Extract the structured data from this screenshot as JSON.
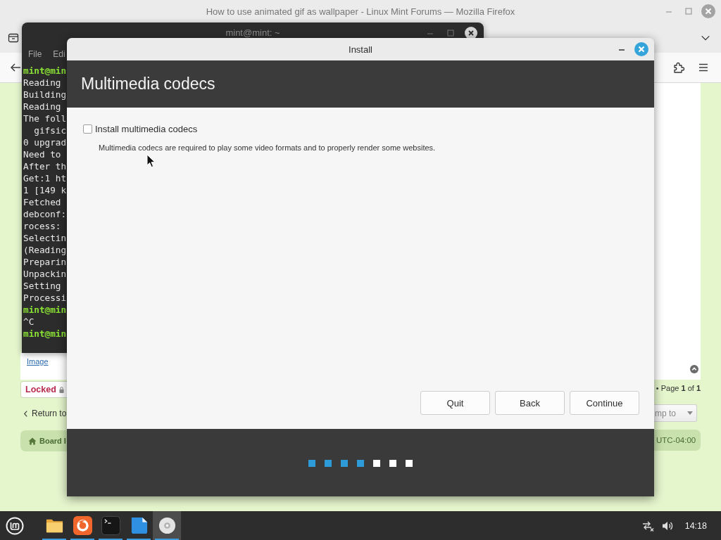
{
  "browser": {
    "title": "How to use animated gif as wallpaper - Linux Mint Forums — Mozilla Firefox",
    "page": {
      "image_link": "Image",
      "locked_button": "Locked",
      "pagination": "• Page **1** of **1**",
      "return_link": "Return to",
      "jump_to": "mp to",
      "breadcrumb": "Board I",
      "timezone": "UTC-04:00"
    }
  },
  "terminal": {
    "title": "mint@mint: ~",
    "menu": [
      "File",
      "Edi"
    ],
    "lines": [
      {
        "kind": "prompt",
        "text": "mint@min"
      },
      {
        "kind": "output",
        "text": "Reading"
      },
      {
        "kind": "output",
        "text": "Building"
      },
      {
        "kind": "output",
        "text": "Reading"
      },
      {
        "kind": "output",
        "text": "The foll"
      },
      {
        "kind": "output",
        "text": "  gifsic"
      },
      {
        "kind": "output",
        "text": "0 upgrad"
      },
      {
        "kind": "output",
        "text": "Need to"
      },
      {
        "kind": "output",
        "text": "After th"
      },
      {
        "kind": "output",
        "text": "Get:1 ht"
      },
      {
        "kind": "output",
        "text": "1 [149 k"
      },
      {
        "kind": "output",
        "text": "Fetched"
      },
      {
        "kind": "output",
        "text": "debconf:"
      },
      {
        "kind": "output",
        "text": "rocess:"
      },
      {
        "kind": "output",
        "text": "Selectin"
      },
      {
        "kind": "output",
        "text": "(Reading"
      },
      {
        "kind": "output",
        "text": "Preparin"
      },
      {
        "kind": "output",
        "text": "Unpackin"
      },
      {
        "kind": "output",
        "text": "Setting"
      },
      {
        "kind": "output",
        "text": "Processi"
      },
      {
        "kind": "prompt",
        "text": "mint@min"
      },
      {
        "kind": "output",
        "text": "^C"
      },
      {
        "kind": "prompt",
        "text": "mint@min"
      }
    ]
  },
  "installer": {
    "title": "Install",
    "heading": "Multimedia codecs",
    "option": {
      "label": "Install multimedia codecs",
      "checked": false
    },
    "description": "Multimedia codecs are required to play some video formats and to properly render some websites.",
    "buttons": [
      "Quit",
      "Back",
      "Continue"
    ],
    "steps": [
      {
        "done": true
      },
      {
        "done": true
      },
      {
        "done": true
      },
      {
        "done": true
      },
      {
        "done": false
      },
      {
        "done": false
      },
      {
        "done": false
      }
    ]
  },
  "taskbar": {
    "apps": [
      {
        "kind": "folder",
        "running": true,
        "selected": false
      },
      {
        "kind": "browser",
        "running": true,
        "selected": false
      },
      {
        "kind": "terminal",
        "running": true,
        "selected": false
      },
      {
        "kind": "document",
        "running": true,
        "selected": false
      },
      {
        "kind": "disc",
        "running": true,
        "selected": true
      }
    ],
    "clock": "14:18"
  }
}
